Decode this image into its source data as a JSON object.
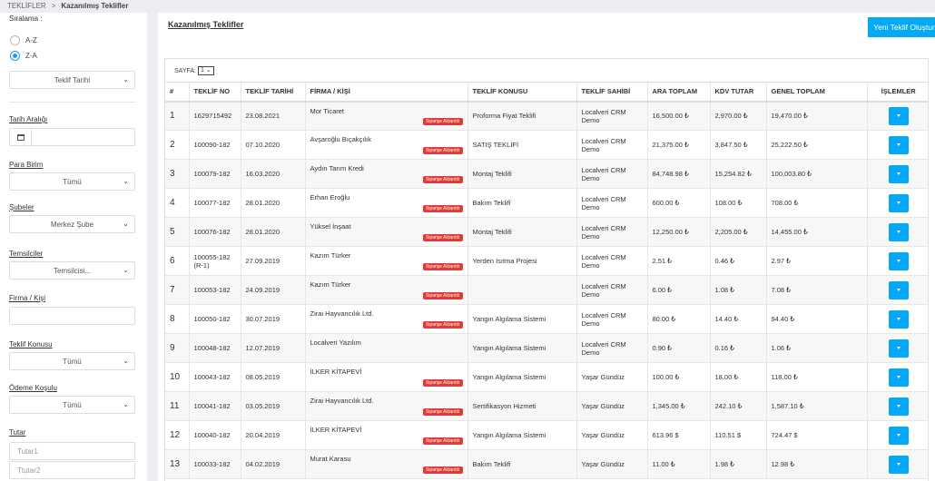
{
  "breadcrumb": {
    "root": "TEKLİFLER",
    "separator": ">",
    "current": "Kazanılmış Teklifler"
  },
  "sidebar": {
    "sort_label": "Sıralama :",
    "sort_options": [
      "A-Z",
      "Z-A"
    ],
    "sort_selected": "Z-A",
    "sort_field": "Teklif Tarihi",
    "date_range_label": "Tarih Aralığı",
    "currency_label": "Para Birim",
    "currency_value": "Tümü",
    "branches_label": "Şubeler",
    "branch_value": "Merkez Şube",
    "reps_label": "Temsilciler",
    "rep_value": "Temsilcisi...",
    "firm_label": "Firma / Kişi",
    "firm_value": "",
    "subject_label": "Teklif Konusu",
    "subject_value": "Tümü",
    "payment_label": "Ödeme Koşulu",
    "payment_value": "Tümü",
    "amount_label": "Tutar",
    "amount1_placeholder": "Tutar1",
    "amount2_placeholder": "Ttutar2"
  },
  "main": {
    "title": "Kazanılmış Teklifler",
    "new_button": "Yeni Teklif Oluştur",
    "pager_label": "SAYFA:",
    "pager_value": "1"
  },
  "table": {
    "headers": [
      "#",
      "TEKLİF NO",
      "TEKLİF TARİHİ",
      "FİRMA / KİŞİ",
      "TEKLİF KONUSU",
      "TEKLİF SAHİBİ",
      "ARA TOPLAM",
      "KDV TUTAR",
      "GENEL TOPLAM",
      "İŞLEMLER"
    ],
    "badge_text": "Siparişe Aktarıldı",
    "rows": [
      {
        "idx": "1",
        "no": "1629715492",
        "date": "23.08.2021",
        "firm": "Mor Ticaret",
        "badge": true,
        "subject": "Proforma Fiyat Teklifi",
        "owner": "Localveri CRM Demo",
        "sub": "16,500.00 ₺",
        "vat": "2,970.00 ₺",
        "total": "19,470.00 ₺"
      },
      {
        "idx": "2",
        "no": "100090-182",
        "date": "07.10.2020",
        "firm": "Avşaroğlu Bıçakçılık",
        "badge": true,
        "subject": "SATIŞ TEKLİFİ",
        "owner": "Localveri CRM Demo",
        "sub": "21,375.00 ₺",
        "vat": "3,847.50 ₺",
        "total": "25,222.50 ₺"
      },
      {
        "idx": "3",
        "no": "100079-182",
        "date": "16.03.2020",
        "firm": "Aydın Tarım Kredi",
        "badge": true,
        "subject": "Montaj Teklifi",
        "owner": "Localveri CRM Demo",
        "sub": "84,748.98 ₺",
        "vat": "15,254.82 ₺",
        "total": "100,003.80 ₺"
      },
      {
        "idx": "4",
        "no": "100077-182",
        "date": "28.01.2020",
        "firm": "Erhan Eroğlu",
        "badge": true,
        "subject": "Bakım Teklifi",
        "owner": "Localveri CRM Demo",
        "sub": "600.00 ₺",
        "vat": "108.00 ₺",
        "total": "708.00 ₺"
      },
      {
        "idx": "5",
        "no": "100076-182",
        "date": "28.01.2020",
        "firm": "Yüksel İnşaat",
        "badge": true,
        "subject": "Montaj Teklifi",
        "owner": "Localveri CRM Demo",
        "sub": "12,250.00 ₺",
        "vat": "2,205.00 ₺",
        "total": "14,455.00 ₺"
      },
      {
        "idx": "6",
        "no": "100055-182 (R-1)",
        "date": "27.09.2019",
        "firm": "Kazım Türker",
        "badge": true,
        "subject": "Yerden Isıtma Projesi",
        "owner": "Localveri CRM Demo",
        "sub": "2.51 ₺",
        "vat": "0.46 ₺",
        "total": "2.97 ₺"
      },
      {
        "idx": "7",
        "no": "100053-182",
        "date": "24.09.2019",
        "firm": "Kazım Türker",
        "badge": true,
        "subject": "",
        "owner": "Localveri CRM Demo",
        "sub": "6.00 ₺",
        "vat": "1.08 ₺",
        "total": "7.08 ₺"
      },
      {
        "idx": "8",
        "no": "100050-182",
        "date": "30.07.2019",
        "firm": "Zirai Hayvancılık Ltd.",
        "badge": true,
        "subject": "Yangın Algılama Sistemi",
        "owner": "Localveri CRM Demo",
        "sub": "80.00 ₺",
        "vat": "14.40 ₺",
        "total": "94.40 ₺"
      },
      {
        "idx": "9",
        "no": "100048-182",
        "date": "12.07.2019",
        "firm": "Localveri Yazılım",
        "badge": false,
        "subject": "Yangın Algılama Sistemi",
        "owner": "Localveri CRM Demo",
        "sub": "0.90 ₺",
        "vat": "0.16 ₺",
        "total": "1.06 ₺"
      },
      {
        "idx": "10",
        "no": "100043-182",
        "date": "08.05.2019",
        "firm": "İLKER KİTAPEVİ",
        "badge": true,
        "subject": "Yangın Algılama Sistemi",
        "owner": "Yaşar Gündüz",
        "sub": "100.00 ₺",
        "vat": "18.00 ₺",
        "total": "118.00 ₺"
      },
      {
        "idx": "11",
        "no": "100041-182",
        "date": "03.05.2019",
        "firm": "Zirai Hayvancılık Ltd.",
        "badge": true,
        "subject": "Sertifikasyon Hizmeti",
        "owner": "Yaşar Gündüz",
        "sub": "1,345.00 ₺",
        "vat": "242.10 ₺",
        "total": "1,587.10 ₺"
      },
      {
        "idx": "12",
        "no": "100040-182",
        "date": "20.04.2019",
        "firm": "İLKER KİTAPEVİ",
        "badge": true,
        "subject": "Yangın Algılama Sistemi",
        "owner": "Yaşar Gündüz",
        "sub": "613.96 $",
        "vat": "110.51 $",
        "total": "724.47 $"
      },
      {
        "idx": "13",
        "no": "100033-182",
        "date": "04.02.2019",
        "firm": "Murat Karasu",
        "badge": true,
        "subject": "Bakım Teklifi",
        "owner": "Yaşar Gündüz",
        "sub": "11.00 ₺",
        "vat": "1.98 ₺",
        "total": "12.98 ₺"
      }
    ]
  },
  "colors": {
    "accent": "#03a9f4",
    "radio": "#2196f3",
    "badge": "#e53935"
  }
}
